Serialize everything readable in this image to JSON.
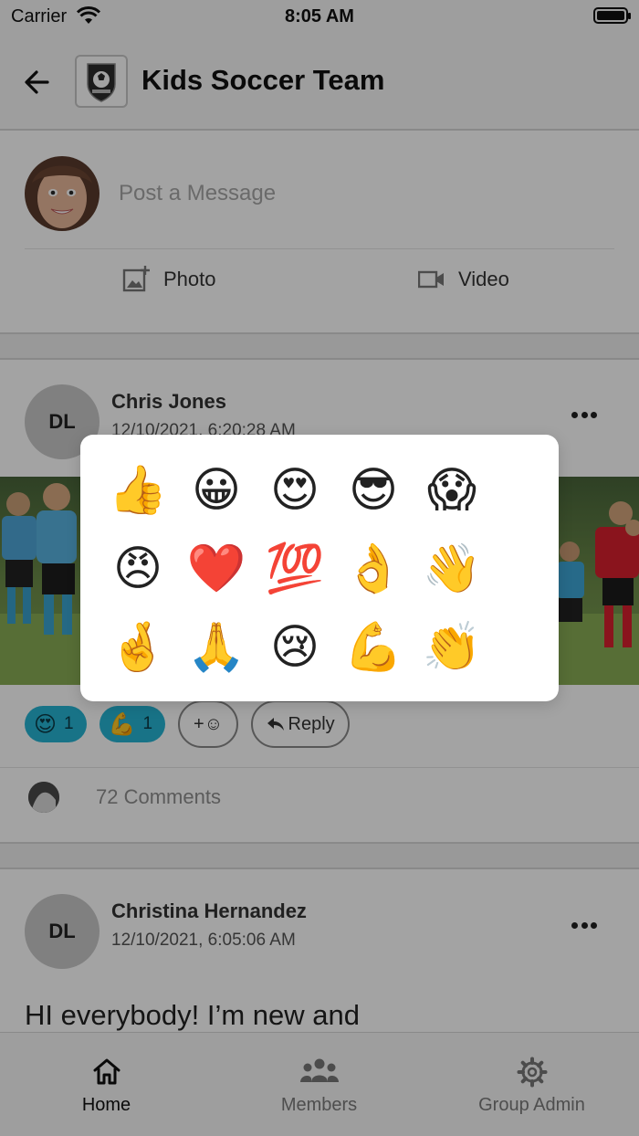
{
  "status_bar": {
    "carrier": "Carrier",
    "time": "8:05 AM"
  },
  "header": {
    "title": "Kids Soccer Team"
  },
  "composer": {
    "placeholder": "Post a Message",
    "photo_label": "Photo",
    "video_label": "Video"
  },
  "posts": [
    {
      "initials": "DL",
      "author": "Chris Jones",
      "timestamp": "12/10/2021, 6:20:28 AM",
      "reactions": [
        {
          "emoji": "😍",
          "count": "1"
        },
        {
          "emoji": "💪",
          "count": "1"
        }
      ],
      "add_reaction_label": "+☺",
      "reply_label": "Reply",
      "comments_label": "72 Comments"
    },
    {
      "initials": "DL",
      "author": "Christina Hernandez",
      "timestamp": "12/10/2021, 6:05:06 AM",
      "body": "HI everybody! I’m new and"
    }
  ],
  "emoji_picker": {
    "emojis": [
      "👍",
      "😀",
      "😍",
      "😎",
      "😱",
      "😠",
      "❤️",
      "💯",
      "👌",
      "👋",
      "🤞",
      "🙏",
      "😢",
      "💪",
      "👏"
    ]
  },
  "tabs": [
    {
      "label": "Home",
      "icon": "home-icon",
      "active": true
    },
    {
      "label": "Members",
      "icon": "members-icon",
      "active": false
    },
    {
      "label": "Group Admin",
      "icon": "gear-icon",
      "active": false
    }
  ],
  "colors": {
    "reaction_chip": "#26b5d3",
    "overlay": "rgba(0,0,0,0.36)"
  }
}
